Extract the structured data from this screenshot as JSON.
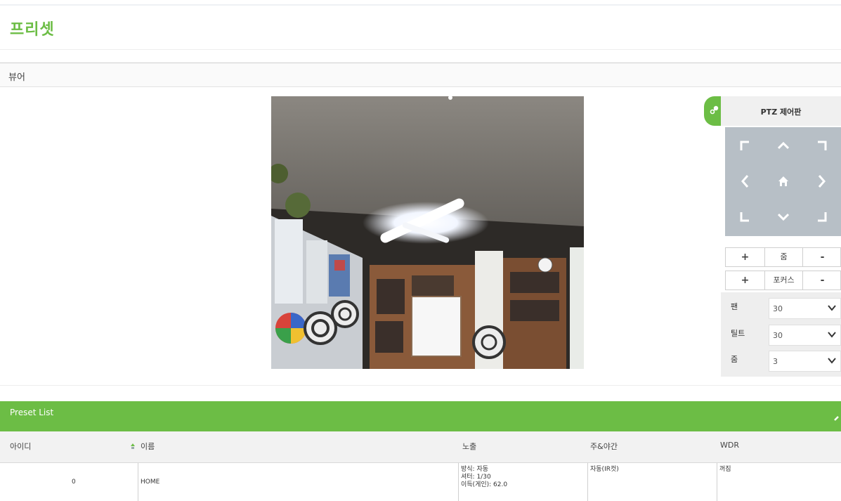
{
  "page": {
    "title": "프리셋"
  },
  "viewer_section": {
    "label": "뷰어"
  },
  "ptz": {
    "title": "PTZ 제어판",
    "zoom_label": "줌",
    "focus_label": "포커스",
    "plus": "+",
    "minus": "-",
    "selects": [
      {
        "label": "팬",
        "value": "30"
      },
      {
        "label": "틸트",
        "value": "30"
      },
      {
        "label": "줌",
        "value": "3"
      }
    ]
  },
  "preset_list": {
    "title": "Preset List",
    "columns": [
      "아이디",
      "이름",
      "노출",
      "주&야간",
      "WDR"
    ],
    "rows": [
      {
        "id": "0",
        "name": "HOME",
        "exposure": [
          "방식: 자동",
          "셔터: 1/30",
          "이득(게인): 62.0"
        ],
        "daynight": "자동(IR컷)",
        "wdr": "꺼짐"
      }
    ]
  },
  "colors": {
    "accent": "#6cbd45",
    "dpad": "#b7bfc6"
  }
}
